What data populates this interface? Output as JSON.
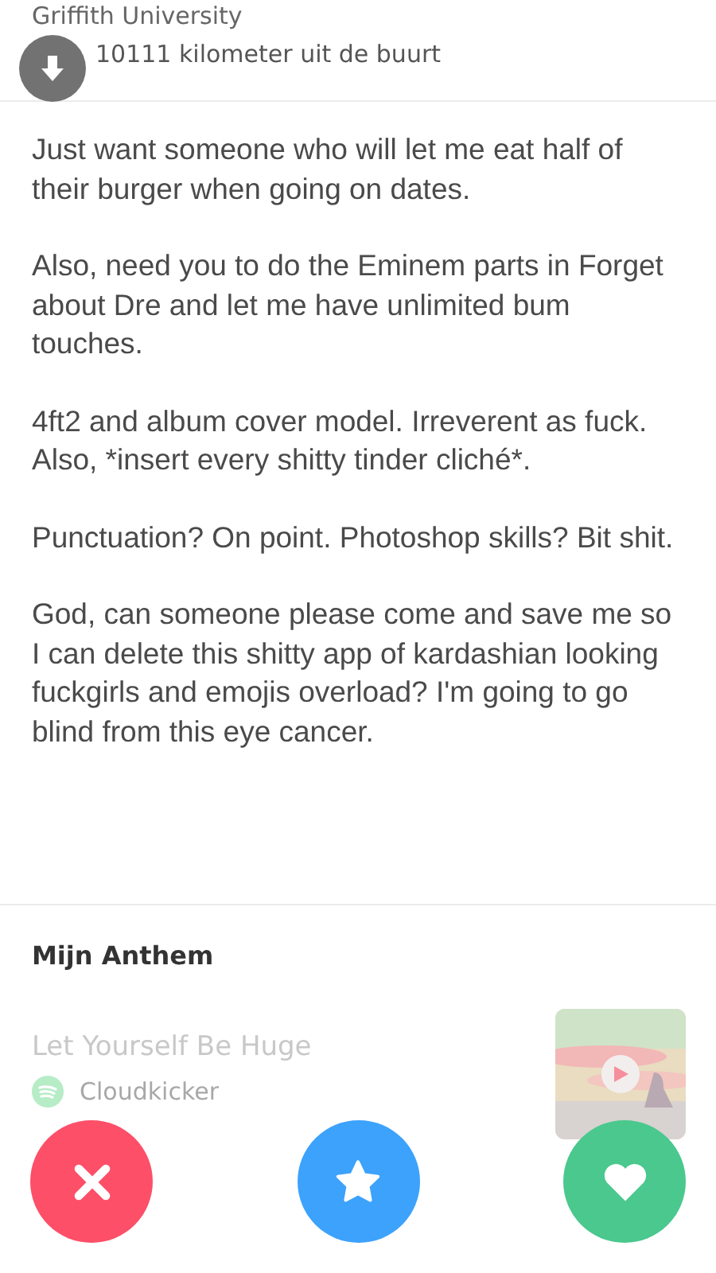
{
  "profile": {
    "school": "Griffith University",
    "distance": "10111 kilometer uit de buurt"
  },
  "bio": [
    "Just want someone who will let me eat half of their burger when going on dates.",
    "Also, need you to do the Eminem parts in Forget about Dre and let me have unlimited bum touches.",
    "4ft2 and album cover model. Irreverent as fuck. Also, *insert every shitty tinder cliché*.",
    "Punctuation? On point. Photoshop skills? Bit shit.",
    "God, can someone please come and save me so I can delete this shitty app of kardashian looking fuckgirls and emojis overload? I'm going to go blind from this eye cancer."
  ],
  "anthem": {
    "heading": "Mijn Anthem",
    "song": "Let Yourself Be Huge",
    "artist": "Cloudkicker"
  },
  "actions": [
    {
      "kind": "nope"
    },
    {
      "kind": "superlike"
    },
    {
      "kind": "like"
    }
  ]
}
